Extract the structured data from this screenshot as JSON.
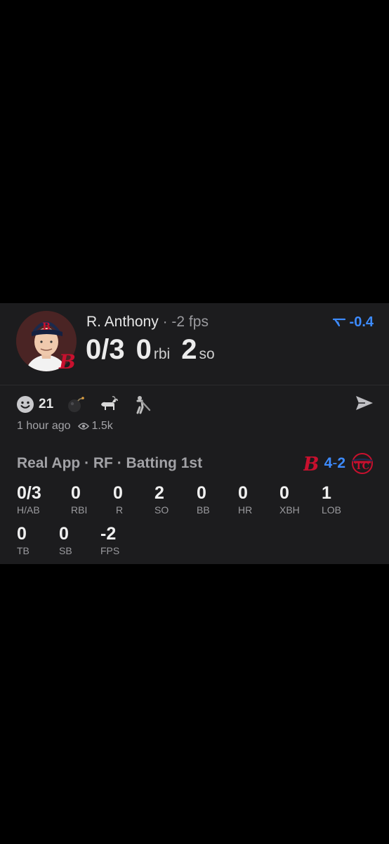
{
  "player": {
    "name": "R. Anthony",
    "separator": "·",
    "fps": "-2 fps",
    "hits_ab": "0/3",
    "rbi_value": "0",
    "rbi_unit": "rbi",
    "so_value": "2",
    "so_unit": "so",
    "delta": "-0.4",
    "delta_icon": "trend-down-icon"
  },
  "reactions": {
    "items": [
      {
        "icon": "smile-icon",
        "count": "21"
      },
      {
        "icon": "bomb-icon",
        "count": ""
      },
      {
        "icon": "goat-icon",
        "count": ""
      },
      {
        "icon": "batter-icon",
        "count": ""
      }
    ],
    "share_icon": "send-icon"
  },
  "meta": {
    "time": "1 hour ago",
    "views": "1.5k",
    "views_icon": "eye-icon"
  },
  "game": {
    "line": "Real App · RF · Batting 1st",
    "score_home": "4",
    "score_dash": "-",
    "score_away": "2",
    "team1_logo": "red-sox-logo",
    "team2_logo": "twins-logo"
  },
  "boxscore": {
    "row1": [
      {
        "value": "0/3",
        "label": "H/AB"
      },
      {
        "value": "0",
        "label": "RBI"
      },
      {
        "value": "0",
        "label": "R"
      },
      {
        "value": "2",
        "label": "SO"
      },
      {
        "value": "0",
        "label": "BB"
      },
      {
        "value": "0",
        "label": "HR"
      },
      {
        "value": "0",
        "label": "XBH"
      },
      {
        "value": "1",
        "label": "LOB"
      }
    ],
    "row2": [
      {
        "value": "0",
        "label": "TB"
      },
      {
        "value": "0",
        "label": "SB"
      },
      {
        "value": "-2",
        "label": "FPS"
      }
    ]
  },
  "colors": {
    "background": "#000000",
    "card": "#1c1c1e",
    "accent_blue": "#3d8bff",
    "red_sox": "#c8102e"
  }
}
